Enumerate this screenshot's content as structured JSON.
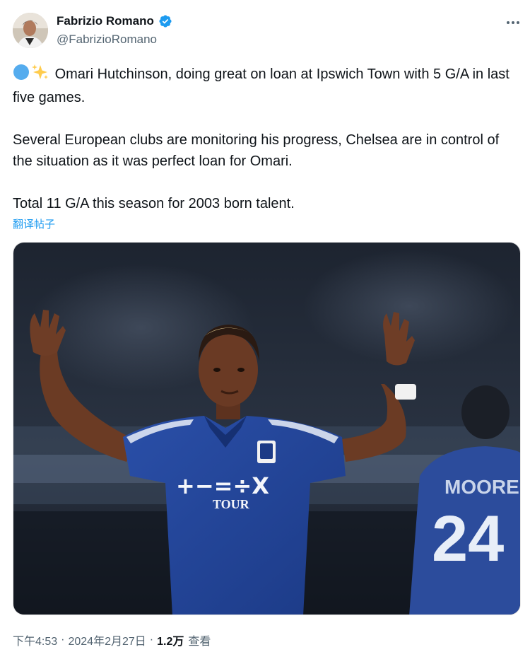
{
  "author": {
    "name": "Fabrizio Romano",
    "handle": "@FabrizioRomano",
    "verified": true,
    "avatar_icon": "user-avatar",
    "verified_color": "#1d9bf0"
  },
  "more_icon": "more-horizontal-icon",
  "tweet": {
    "emojis": [
      "blue-circle-emoji",
      "sparkles-emoji"
    ],
    "paragraphs": [
      "Omari Hutchinson, doing great on loan at Ipswich Town with 5 G/A in last five games.",
      "Several European clubs are monitoring his progress, Chelsea are in control of the situation as it was perfect loan for Omari.",
      "Total 11 G/A this season for 2003 born talent."
    ],
    "translate_label": "翻译帖子"
  },
  "media": {
    "jersey_sponsor": "+−=÷X",
    "jersey_sponsor_sub": "TOUR",
    "background_player_name": "MOORE",
    "background_player_number": "24"
  },
  "meta": {
    "time": "下午4:53",
    "date": "2024年2月27日",
    "views_count": "1.2万",
    "views_label": "查看"
  }
}
